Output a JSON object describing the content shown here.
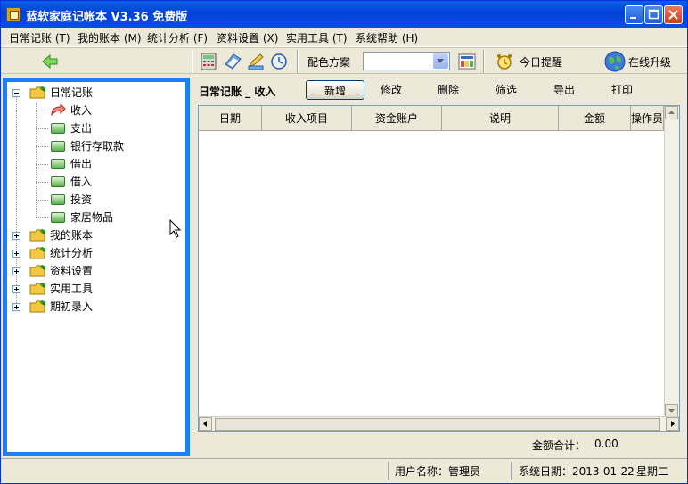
{
  "window": {
    "title": "蓝软家庭记帐本 V3.36  免费版"
  },
  "menu": [
    {
      "label": "日常记账 (T)"
    },
    {
      "label": "我的账本 (M)"
    },
    {
      "label": "统计分析 (F)"
    },
    {
      "label": "资料设置 (X)"
    },
    {
      "label": "实用工具 (T)"
    },
    {
      "label": "系统帮助 (H)"
    }
  ],
  "toolbar": {
    "scheme_label": "配色方案",
    "scheme_value": "",
    "remind_label": "今日提醒",
    "upgrade_label": "在线升级"
  },
  "tree": {
    "root": "日常记账",
    "children": [
      "收入",
      "支出",
      "银行存取款",
      "借出",
      "借入",
      "投资",
      "家居物品"
    ],
    "others": [
      "我的账本",
      "统计分析",
      "资料设置",
      "实用工具",
      "期初录入"
    ]
  },
  "main": {
    "section_title": "日常记账 _ 收入",
    "actions": {
      "new": "新增",
      "edit": "修改",
      "delete": "删除",
      "filter": "筛选",
      "export": "导出",
      "print": "打印"
    },
    "columns": [
      "日期",
      "收入项目",
      "资金账户",
      "说明",
      "金额",
      "操作员"
    ],
    "sum_label": "金额合计：",
    "sum_value": "0.00"
  },
  "status": {
    "user": "用户名称：管理员",
    "date": "系统日期：2013-01-22",
    "weekday": "星期二"
  },
  "colors": {
    "accent": "#1e7ffa",
    "titlebar": "#0342d6"
  }
}
